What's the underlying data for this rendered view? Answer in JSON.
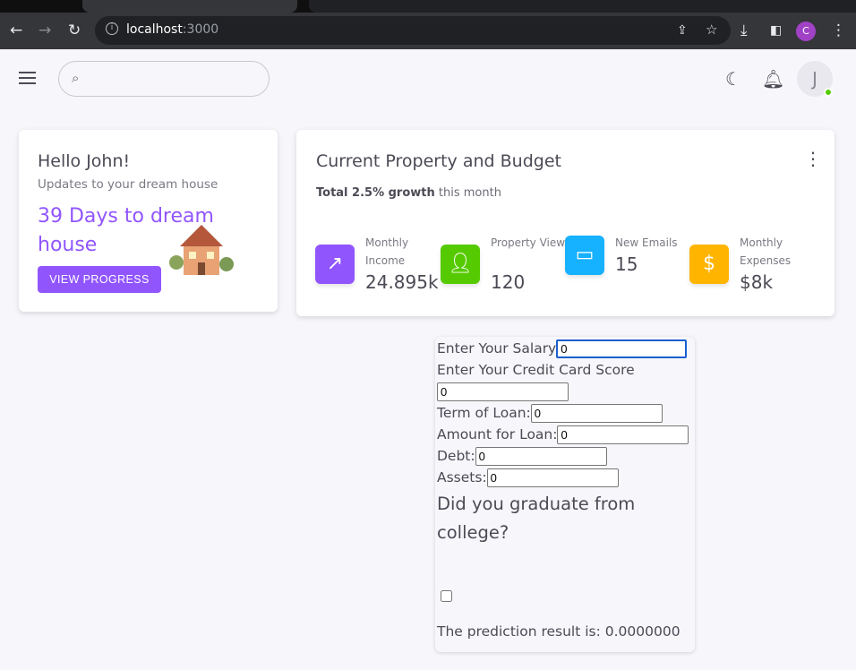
{
  "browser": {
    "url_host": "localhost",
    "url_port": ":3000",
    "profile_initial": "C"
  },
  "appbar": {
    "search_placeholder": "",
    "avatar_initial": "J",
    "status_color": "#56ca00"
  },
  "welcome": {
    "title": "Hello John!",
    "subtitle": "Updates to your dream house",
    "headline": "39 Days to dream house",
    "button": "VIEW PROGRESS"
  },
  "budget": {
    "title": "Current Property and Budget",
    "growth_bold": "Total 2.5% growth",
    "growth_rest": " this month",
    "stats": [
      {
        "label": "Monthly Income",
        "value": "24.895k",
        "icon": "trending-up-icon",
        "color": "#9155fd"
      },
      {
        "label": "Property Views",
        "value": "120",
        "icon": "account-icon",
        "color": "#56ca00"
      },
      {
        "label": "New Emails",
        "value": "15",
        "icon": "devices-icon",
        "color": "#16b1ff"
      },
      {
        "label": "Monthly Expenses",
        "value": "$8k",
        "icon": "dollar-icon",
        "color": "#ffb400"
      }
    ]
  },
  "form": {
    "salary_label": "Enter Your Salary",
    "salary": "0",
    "credit_label": "Enter Your Credit Card Score",
    "credit": "0",
    "term_label": "Term of Loan:",
    "term": "0",
    "amount_label": "Amount for Loan:",
    "amount": "0",
    "debt_label": "Debt:",
    "debt": "0",
    "assets_label": "Assets:",
    "assets": "0",
    "college_q": "Did you graduate from college?",
    "graduated": false,
    "result_label": "The prediction result is: ",
    "result": "0.0000000"
  }
}
